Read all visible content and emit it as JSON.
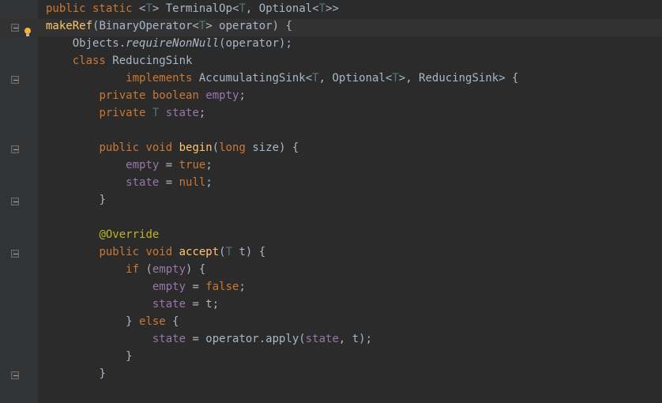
{
  "editor": {
    "lines": [
      {
        "indent": 0,
        "tokens": [
          {
            "cls": "kw",
            "t": "public static "
          },
          {
            "cls": "paren",
            "t": "<"
          },
          {
            "cls": "type",
            "t": "T"
          },
          {
            "cls": "paren",
            "t": "> "
          },
          {
            "cls": "ident",
            "t": "TerminalOp<"
          },
          {
            "cls": "type",
            "t": "T"
          },
          {
            "cls": "ident",
            "t": ", Optional<"
          },
          {
            "cls": "type",
            "t": "T"
          },
          {
            "cls": "ident",
            "t": ">>"
          }
        ]
      },
      {
        "indent": 0,
        "tokens": [
          {
            "cls": "method-decl",
            "t": "makeRef"
          },
          {
            "cls": "paren",
            "t": "("
          },
          {
            "cls": "ident",
            "t": "BinaryOperator<"
          },
          {
            "cls": "type",
            "t": "T"
          },
          {
            "cls": "ident",
            "t": "> operator"
          },
          {
            "cls": "paren",
            "t": ") {"
          }
        ]
      },
      {
        "indent": 1,
        "tokens": [
          {
            "cls": "ident",
            "t": "Objects."
          },
          {
            "cls": "str-ital",
            "t": "requireNonNull"
          },
          {
            "cls": "ident",
            "t": "(operator);"
          }
        ]
      },
      {
        "indent": 1,
        "tokens": [
          {
            "cls": "kw",
            "t": "class "
          },
          {
            "cls": "ident",
            "t": "ReducingSink"
          }
        ]
      },
      {
        "indent": 3,
        "tokens": [
          {
            "cls": "kw",
            "t": "implements "
          },
          {
            "cls": "ident",
            "t": "AccumulatingSink<"
          },
          {
            "cls": "type",
            "t": "T"
          },
          {
            "cls": "ident",
            "t": ", Optional<"
          },
          {
            "cls": "type",
            "t": "T"
          },
          {
            "cls": "ident",
            "t": ">, ReducingSink> {"
          }
        ]
      },
      {
        "indent": 2,
        "tokens": [
          {
            "cls": "kw",
            "t": "private boolean "
          },
          {
            "cls": "field",
            "t": "empty"
          },
          {
            "cls": "ident",
            "t": ";"
          }
        ]
      },
      {
        "indent": 2,
        "tokens": [
          {
            "cls": "kw",
            "t": "private "
          },
          {
            "cls": "type",
            "t": "T "
          },
          {
            "cls": "field",
            "t": "state"
          },
          {
            "cls": "ident",
            "t": ";"
          }
        ]
      },
      {
        "indent": 0,
        "tokens": [
          {
            "cls": "ident",
            "t": ""
          }
        ]
      },
      {
        "indent": 2,
        "tokens": [
          {
            "cls": "kw",
            "t": "public void "
          },
          {
            "cls": "method-decl",
            "t": "begin"
          },
          {
            "cls": "paren",
            "t": "("
          },
          {
            "cls": "kw",
            "t": "long "
          },
          {
            "cls": "ident",
            "t": "size"
          },
          {
            "cls": "paren",
            "t": ") {"
          }
        ]
      },
      {
        "indent": 3,
        "tokens": [
          {
            "cls": "field",
            "t": "empty"
          },
          {
            "cls": "ident",
            "t": " = "
          },
          {
            "cls": "kw",
            "t": "true"
          },
          {
            "cls": "ident",
            "t": ";"
          }
        ]
      },
      {
        "indent": 3,
        "tokens": [
          {
            "cls": "field",
            "t": "state"
          },
          {
            "cls": "ident",
            "t": " = "
          },
          {
            "cls": "kw",
            "t": "null"
          },
          {
            "cls": "ident",
            "t": ";"
          }
        ]
      },
      {
        "indent": 2,
        "tokens": [
          {
            "cls": "paren",
            "t": "}"
          }
        ]
      },
      {
        "indent": 0,
        "tokens": [
          {
            "cls": "ident",
            "t": ""
          }
        ]
      },
      {
        "indent": 2,
        "tokens": [
          {
            "cls": "ann",
            "t": "@Override"
          }
        ]
      },
      {
        "indent": 2,
        "tokens": [
          {
            "cls": "kw",
            "t": "public void "
          },
          {
            "cls": "method-decl",
            "t": "accept"
          },
          {
            "cls": "paren",
            "t": "("
          },
          {
            "cls": "type",
            "t": "T "
          },
          {
            "cls": "ident",
            "t": "t"
          },
          {
            "cls": "paren",
            "t": ") {"
          }
        ]
      },
      {
        "indent": 3,
        "tokens": [
          {
            "cls": "kw",
            "t": "if "
          },
          {
            "cls": "paren",
            "t": "("
          },
          {
            "cls": "field",
            "t": "empty"
          },
          {
            "cls": "paren",
            "t": ") {"
          }
        ]
      },
      {
        "indent": 4,
        "tokens": [
          {
            "cls": "field",
            "t": "empty"
          },
          {
            "cls": "ident",
            "t": " = "
          },
          {
            "cls": "kw",
            "t": "false"
          },
          {
            "cls": "ident",
            "t": ";"
          }
        ]
      },
      {
        "indent": 4,
        "tokens": [
          {
            "cls": "field",
            "t": "state"
          },
          {
            "cls": "ident",
            "t": " = t;"
          }
        ]
      },
      {
        "indent": 3,
        "tokens": [
          {
            "cls": "paren",
            "t": "} "
          },
          {
            "cls": "kw",
            "t": "else "
          },
          {
            "cls": "paren",
            "t": "{"
          }
        ]
      },
      {
        "indent": 4,
        "tokens": [
          {
            "cls": "field",
            "t": "state"
          },
          {
            "cls": "ident",
            "t": " = operator.apply("
          },
          {
            "cls": "field",
            "t": "state"
          },
          {
            "cls": "ident",
            "t": ", t);"
          }
        ]
      },
      {
        "indent": 3,
        "tokens": [
          {
            "cls": "paren",
            "t": "}"
          }
        ]
      },
      {
        "indent": 2,
        "tokens": [
          {
            "cls": "paren",
            "t": "}"
          }
        ]
      }
    ]
  },
  "gutter": {
    "fold_icons_rows": [
      1,
      4,
      8,
      11,
      14,
      21
    ],
    "bulb_row": 1,
    "highlight_row": 1
  }
}
